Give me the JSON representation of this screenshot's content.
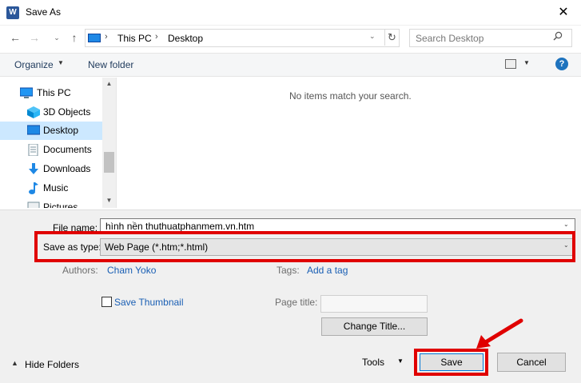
{
  "window": {
    "title": "Save As",
    "app_icon_letter": "W",
    "close_glyph": "✕"
  },
  "nav_buttons": {
    "back": "←",
    "forward": "→",
    "recent": "⌄",
    "up": "↑"
  },
  "address": {
    "breadcrumbs": [
      "This PC",
      "Desktop"
    ],
    "separator": "›",
    "dropdown": "⌄",
    "refresh": "↻"
  },
  "search": {
    "placeholder": "Search Desktop",
    "icon": "search-icon"
  },
  "toolbar": {
    "organize_label": "Organize",
    "chevron": "▼",
    "new_folder_label": "New folder",
    "help_glyph": "?"
  },
  "nav_pane": {
    "items": [
      {
        "label": "This PC",
        "icon": "pc-icon",
        "color": "#2196f3",
        "selected": false
      },
      {
        "label": "3D Objects",
        "icon": "cube-icon",
        "color": "#29b6f6",
        "selected": false
      },
      {
        "label": "Desktop",
        "icon": "desktop-icon",
        "color": "#1e88e5",
        "selected": true
      },
      {
        "label": "Documents",
        "icon": "document-icon",
        "color": "#78909c",
        "selected": false
      },
      {
        "label": "Downloads",
        "icon": "download-icon",
        "color": "#1e88e5",
        "selected": false
      },
      {
        "label": "Music",
        "icon": "music-icon",
        "color": "#1e88e5",
        "selected": false
      },
      {
        "label": "Pictures",
        "icon": "pictures-icon",
        "color": "#78909c",
        "selected": false
      }
    ],
    "scroll_up": "▲",
    "scroll_down": "▼"
  },
  "content": {
    "empty_message": "No items match your search."
  },
  "form": {
    "file_name_label": "File name:",
    "file_name_value": "hình nền thuthuatphanmem.vn.htm",
    "save_as_type_label": "Save as type:",
    "save_as_type_value": "Web Page (*.htm;*.html)",
    "dropdown_glyph": "⌄",
    "authors_label": "Authors:",
    "authors_value": "Cham Yoko",
    "tags_label": "Tags:",
    "tags_value": "Add a tag",
    "save_thumbnail_label": "Save Thumbnail",
    "save_thumbnail_checked": false,
    "page_title_label": "Page title:",
    "page_title_value": "",
    "change_title_label": "Change Title..."
  },
  "footer": {
    "hide_folders_label": "Hide Folders",
    "hide_folders_chevron": "▲",
    "tools_label": "Tools",
    "tools_chevron": "▼",
    "save_label": "Save",
    "cancel_label": "Cancel"
  },
  "colors": {
    "highlight": "#e00000",
    "link": "#1a5fb4",
    "selection": "#cce8ff",
    "accent": "#0078d7"
  }
}
